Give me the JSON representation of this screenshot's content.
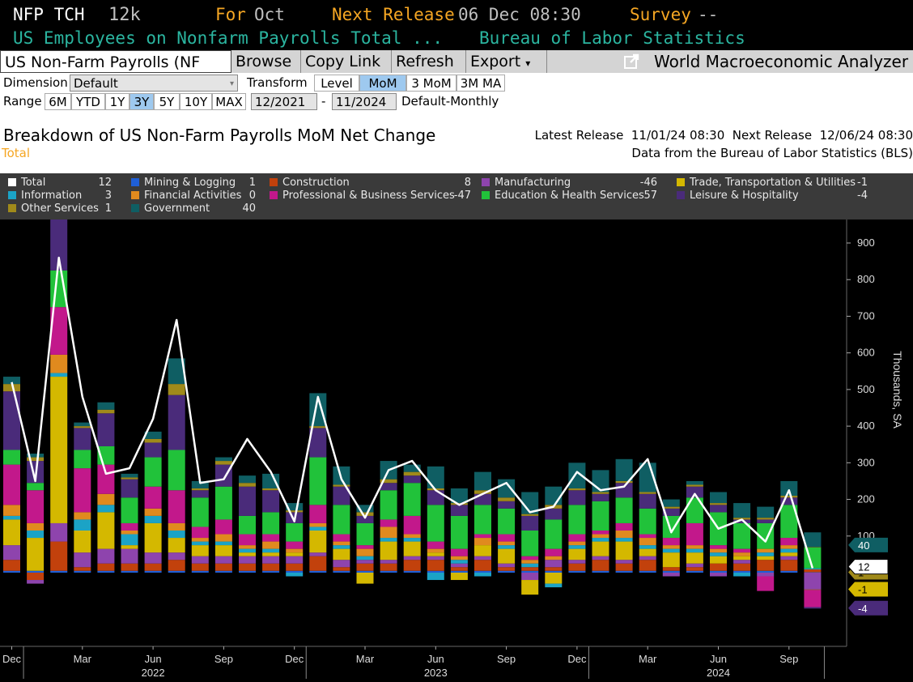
{
  "ticker": {
    "symbol": "NFP TCH",
    "value": "12k",
    "for_label": "For",
    "for_value": "Oct",
    "next_release_label": "Next Release",
    "next_release_value": "06 Dec 08:30",
    "survey_label": "Survey",
    "survey_value": "--",
    "description": "US Employees on Nonfarm Payrolls Total ...",
    "source": "Bureau of Labor Statistics"
  },
  "toolbar": {
    "title": "US Non-Farm Payrolls (NF",
    "browse": "Browse",
    "copy_link": "Copy Link",
    "refresh": "Refresh",
    "export": "Export",
    "export_caret": "▾",
    "app_name": "World Macroeconomic Analyzer",
    "launch_icon": "external-link-icon"
  },
  "controls": {
    "dimension_label": "Dimension",
    "dimension_value": "Default",
    "transform_label": "Transform",
    "transform_options": [
      "Level",
      "MoM",
      "3 MoM",
      "3M MA"
    ],
    "transform_selected": "MoM",
    "range_label": "Range",
    "range_options": [
      "6M",
      "YTD",
      "1Y",
      "3Y",
      "5Y",
      "10Y",
      "MAX"
    ],
    "range_selected": "3Y",
    "start_date": "12/2021",
    "date_sep": "-",
    "end_date": "11/2024",
    "frequency": "Default-Monthly"
  },
  "header": {
    "title": "Breakdown of US Non-Farm Payrolls MoM Net Change",
    "subtitle": "Total",
    "latest_release": "Latest Release  11/01/24 08:30  Next Release  12/06/24 08:30",
    "data_source": "Data from the Bureau of Labor Statistics (BLS)"
  },
  "colors": {
    "total": "#ffffff",
    "mining": "#1f5fd6",
    "construction": "#c2410c",
    "manufacturing": "#8e44ad",
    "trade": "#d4b800",
    "information": "#1ba3c6",
    "financial": "#e08a1e",
    "professional": "#c2188b",
    "education": "#21c23a",
    "leisure": "#4a2b7a",
    "other": "#a08a1a",
    "government": "#0f5e63"
  },
  "legend": [
    {
      "key": "total",
      "label": "Total",
      "value": "12"
    },
    {
      "key": "mining",
      "label": "Mining & Logging",
      "value": "1"
    },
    {
      "key": "construction",
      "label": "Construction",
      "value": "8"
    },
    {
      "key": "manufacturing",
      "label": "Manufacturing",
      "value": "-46"
    },
    {
      "key": "trade",
      "label": "Trade, Transportation & Utilities",
      "value": "-1"
    },
    {
      "key": "information",
      "label": "Information",
      "value": "3"
    },
    {
      "key": "financial",
      "label": "Financial Activities",
      "value": "0"
    },
    {
      "key": "professional",
      "label": "Professional & Business Services",
      "value": "-47"
    },
    {
      "key": "education",
      "label": "Education & Health Services",
      "value": "57"
    },
    {
      "key": "leisure",
      "label": "Leisure & Hospitality",
      "value": "-4"
    },
    {
      "key": "other",
      "label": "Other Services",
      "value": "1"
    },
    {
      "key": "government",
      "label": "Government",
      "value": "40"
    }
  ],
  "chart_data": {
    "type": "bar",
    "stacked": true,
    "ylabel": "Thousands, SA",
    "ylim": [
      -200,
      920
    ],
    "yticks": [
      900,
      800,
      700,
      600,
      500,
      400,
      300,
      200,
      100
    ],
    "x_labels": [
      "Dec",
      "Mar",
      "Jun",
      "Sep",
      "Dec",
      "Mar",
      "Jun",
      "Sep",
      "Dec",
      "Mar",
      "Jun",
      "Sep"
    ],
    "year_labels": [
      "2022",
      "2023",
      "2024"
    ],
    "categories": [
      "Dec 21",
      "Jan 22",
      "Feb 22",
      "Mar 22",
      "Apr 22",
      "May 22",
      "Jun 22",
      "Jul 22",
      "Aug 22",
      "Sep 22",
      "Oct 22",
      "Nov 22",
      "Dec 22",
      "Jan 23",
      "Feb 23",
      "Mar 23",
      "Apr 23",
      "May 23",
      "Jun 23",
      "Jul 23",
      "Aug 23",
      "Sep 23",
      "Oct 23",
      "Nov 23",
      "Dec 23",
      "Jan 24",
      "Feb 24",
      "Mar 24",
      "Apr 24",
      "May 24",
      "Jun 24",
      "Jul 24",
      "Aug 24",
      "Sep 24",
      "Oct 24"
    ],
    "total": [
      520,
      250,
      860,
      480,
      270,
      285,
      420,
      690,
      245,
      255,
      365,
      275,
      140,
      480,
      255,
      150,
      280,
      305,
      225,
      185,
      215,
      245,
      165,
      180,
      275,
      225,
      235,
      310,
      110,
      215,
      120,
      145,
      85,
      225,
      12
    ],
    "series": [
      {
        "key": "government",
        "name": "Government",
        "values": [
          20,
          10,
          40,
          10,
          20,
          10,
          20,
          70,
          20,
          10,
          20,
          40,
          20,
          90,
          50,
          20,
          50,
          20,
          60,
          40,
          50,
          50,
          60,
          50,
          70,
          60,
          60,
          80,
          20,
          10,
          30,
          40,
          30,
          40,
          40
        ]
      },
      {
        "key": "other",
        "name": "Other Services",
        "values": [
          20,
          10,
          10,
          5,
          10,
          5,
          10,
          30,
          5,
          10,
          10,
          5,
          5,
          5,
          5,
          10,
          10,
          10,
          5,
          5,
          10,
          10,
          5,
          10,
          5,
          5,
          5,
          5,
          5,
          5,
          5,
          5,
          5,
          5,
          1
        ]
      },
      {
        "key": "leisure",
        "name": "Leisure & Hospitality",
        "values": [
          160,
          60,
          150,
          60,
          90,
          50,
          40,
          150,
          20,
          60,
          80,
          60,
          30,
          80,
          50,
          20,
          20,
          20,
          40,
          30,
          30,
          20,
          40,
          30,
          40,
          20,
          40,
          40,
          20,
          30,
          20,
          10,
          10,
          20,
          -4
        ]
      },
      {
        "key": "education",
        "name": "Education & Health Services",
        "values": [
          40,
          20,
          100,
          50,
          50,
          70,
          80,
          110,
          80,
          90,
          50,
          60,
          50,
          130,
          80,
          60,
          80,
          90,
          100,
          90,
          80,
          70,
          70,
          80,
          80,
          80,
          70,
          70,
          60,
          70,
          90,
          70,
          70,
          90,
          57
        ]
      },
      {
        "key": "professional",
        "name": "Professional & Business Services",
        "values": [
          110,
          90,
          130,
          120,
          80,
          20,
          60,
          90,
          30,
          40,
          30,
          20,
          20,
          50,
          20,
          10,
          20,
          50,
          20,
          20,
          10,
          20,
          10,
          20,
          20,
          10,
          20,
          10,
          20,
          60,
          10,
          10,
          -40,
          20,
          -47
        ]
      },
      {
        "key": "financial",
        "name": "Financial Activities",
        "values": [
          30,
          20,
          50,
          20,
          30,
          10,
          20,
          20,
          10,
          20,
          10,
          20,
          10,
          10,
          10,
          20,
          30,
          10,
          10,
          10,
          20,
          10,
          10,
          10,
          10,
          10,
          20,
          20,
          10,
          10,
          10,
          10,
          10,
          10,
          0
        ]
      },
      {
        "key": "information",
        "name": "Information",
        "values": [
          10,
          20,
          10,
          30,
          20,
          30,
          20,
          20,
          10,
          10,
          10,
          10,
          -10,
          10,
          10,
          10,
          10,
          10,
          -20,
          10,
          -10,
          10,
          10,
          -10,
          10,
          10,
          10,
          10,
          10,
          10,
          10,
          -10,
          10,
          10,
          3
        ]
      },
      {
        "key": "trade",
        "name": "Trade, Transportation & Utilities",
        "values": [
          70,
          90,
          400,
          60,
          100,
          10,
          80,
          40,
          30,
          30,
          10,
          10,
          10,
          60,
          30,
          -30,
          50,
          40,
          10,
          -20,
          30,
          40,
          -40,
          -30,
          30,
          40,
          50,
          20,
          40,
          30,
          20,
          10,
          10,
          10,
          -1
        ]
      },
      {
        "key": "manufacturing",
        "name": "Manufacturing",
        "values": [
          40,
          -10,
          50,
          40,
          40,
          40,
          30,
          20,
          20,
          20,
          20,
          20,
          20,
          10,
          20,
          10,
          10,
          10,
          10,
          10,
          10,
          10,
          -20,
          20,
          10,
          10,
          10,
          10,
          -10,
          10,
          -10,
          10,
          -10,
          10,
          -46
        ]
      },
      {
        "key": "construction",
        "name": "Construction",
        "values": [
          30,
          -20,
          80,
          10,
          20,
          20,
          20,
          30,
          20,
          20,
          20,
          20,
          20,
          40,
          10,
          20,
          20,
          30,
          30,
          10,
          30,
          10,
          10,
          10,
          20,
          30,
          20,
          30,
          10,
          10,
          20,
          20,
          30,
          30,
          8
        ]
      },
      {
        "key": "mining",
        "name": "Mining & Logging",
        "values": [
          5,
          5,
          5,
          5,
          5,
          5,
          5,
          5,
          5,
          5,
          5,
          5,
          5,
          5,
          5,
          5,
          5,
          5,
          5,
          5,
          5,
          5,
          5,
          5,
          5,
          5,
          5,
          5,
          5,
          5,
          5,
          5,
          5,
          5,
          1
        ]
      }
    ],
    "right_tags": [
      {
        "key": "government",
        "value": "40"
      },
      {
        "key": "other",
        "value": "1"
      },
      {
        "key": "total",
        "value": "12"
      },
      {
        "key": "trade",
        "value": "-1"
      },
      {
        "key": "leisure",
        "value": "-4"
      }
    ]
  }
}
